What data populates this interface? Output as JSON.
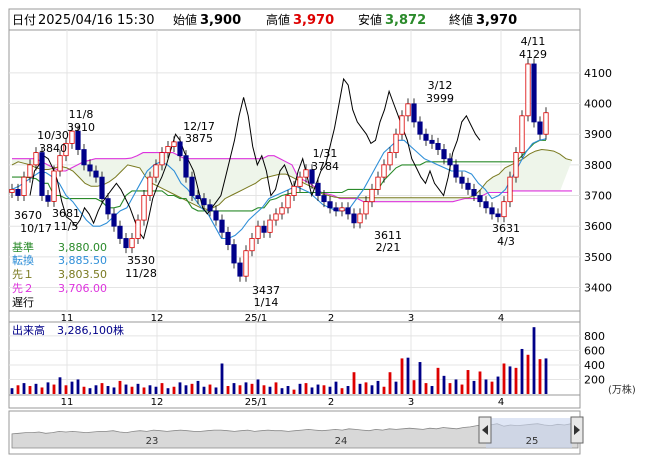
{
  "header": {
    "date_label": "日付",
    "date": "2025/04/16 15:30",
    "open_label": "始値",
    "open": "3,900",
    "high_label": "高値",
    "high": "3,970",
    "low_label": "安値",
    "low": "3,872",
    "close_label": "終値",
    "close": "3,970"
  },
  "legend": {
    "kijun_label": "基準",
    "kijun_value": "3,880.00",
    "tenkan_label": "転換",
    "tenkan_value": "3,885.50",
    "senkou1_label": "先１",
    "senkou1_value": "3,803.50",
    "senkou2_label": "先２",
    "senkou2_value": "3,706.00",
    "chikou_label": "遅行"
  },
  "volume_panel": {
    "label": "出来高",
    "value": "3,286,100株",
    "unit": "(万株)"
  },
  "colors": {
    "up": "#dd0000",
    "down": "#000088",
    "kijun": "#2a8a2a",
    "tenkan": "#2f8fd8",
    "senkou1": "#7a7a20",
    "senkou2": "#dd33dd",
    "chikou": "#000000",
    "cloud": "#eef5ea"
  },
  "chart_data": [
    {
      "type": "candlestick",
      "title": "",
      "y_ticks": [
        3400,
        3500,
        3600,
        3700,
        3800,
        3900,
        4000,
        4100
      ],
      "ylim": [
        3330,
        4230
      ],
      "x_ticks": [
        "11",
        "12",
        "25/1",
        "2",
        "3",
        "4"
      ],
      "series": [
        {
          "name": "kijun",
          "values": [
            3760,
            3760,
            3760,
            3758,
            3755,
            3740,
            3740,
            3700,
            3700,
            3690,
            3690,
            3690,
            3690,
            3690,
            3690,
            3680,
            3660,
            3660,
            3665,
            3700,
            3715,
            3715,
            3715,
            3715,
            3715,
            3715,
            3700,
            3700,
            3690,
            3690,
            3660,
            3650,
            3650,
            3650,
            3650,
            3650,
            3650,
            3650,
            3650,
            3650,
            3650,
            3660,
            3660,
            3685,
            3690,
            3700,
            3705,
            3710,
            3710,
            3710,
            3710,
            3710,
            3710,
            3710,
            3710,
            3710,
            3720,
            3720,
            3720,
            3720,
            3720,
            3720,
            3750,
            3770,
            3790,
            3800,
            3800,
            3800,
            3800,
            3810,
            3810,
            3810,
            3810,
            3810,
            3810,
            3810,
            3810,
            3810,
            3810,
            3810,
            3810,
            3810,
            3810,
            3810,
            3810,
            3830,
            3850,
            3870,
            3880,
            3880
          ]
        },
        {
          "name": "tenkan",
          "values": [
            3720,
            3730,
            3745,
            3760,
            3775,
            3775,
            3760,
            3740,
            3700,
            3680,
            3650,
            3620,
            3600,
            3600,
            3610,
            3630,
            3650,
            3660,
            3700,
            3740,
            3780,
            3800,
            3810,
            3800,
            3780,
            3740,
            3720,
            3690,
            3660,
            3640,
            3600,
            3560,
            3560,
            3570,
            3590,
            3620,
            3640,
            3660,
            3690,
            3700,
            3710,
            3720,
            3730,
            3720,
            3710,
            3690,
            3670,
            3660,
            3650,
            3650,
            3660,
            3690,
            3720,
            3760,
            3800,
            3840,
            3860,
            3880,
            3880,
            3860,
            3840,
            3820,
            3810,
            3800,
            3790,
            3780,
            3780,
            3780,
            3770,
            3740,
            3720,
            3690,
            3700,
            3720,
            3760,
            3800,
            3840,
            3870,
            3880,
            3885
          ]
        },
        {
          "name": "senkou1",
          "values": [
            3800,
            3810,
            3805,
            3800,
            3790,
            3785,
            3785,
            3790,
            3795,
            3790,
            3780,
            3760,
            3740,
            3730,
            3730,
            3735,
            3745,
            3760,
            3780,
            3800,
            3795,
            3790,
            3760,
            3740,
            3730,
            3720,
            3710,
            3700,
            3690,
            3680,
            3670,
            3660,
            3655,
            3660,
            3670,
            3690,
            3700,
            3710,
            3720,
            3730,
            3740,
            3755,
            3760,
            3765,
            3770,
            3770,
            3760,
            3750,
            3740,
            3730,
            3720,
            3705,
            3700,
            3695,
            3693,
            3693,
            3693,
            3693,
            3693,
            3693,
            3693,
            3693,
            3693,
            3693,
            3693,
            3693,
            3693,
            3693,
            3693,
            3693,
            3693,
            3693,
            3693,
            3693,
            3693,
            3693,
            3700,
            3720,
            3745,
            3760,
            3770,
            3790,
            3800,
            3810,
            3820,
            3835,
            3845,
            3850,
            3848,
            3845,
            3835,
            3820,
            3815
          ]
        },
        {
          "name": "senkou2",
          "values": [
            3820,
            3820,
            3820,
            3820,
            3820,
            3810,
            3800,
            3790,
            3780,
            3780,
            3790,
            3800,
            3810,
            3815,
            3820,
            3820,
            3820,
            3820,
            3820,
            3820,
            3822,
            3830,
            3840,
            3840,
            3840,
            3840,
            3840,
            3840,
            3830,
            3820,
            3820,
            3820,
            3820,
            3820,
            3820,
            3820,
            3820,
            3820,
            3820,
            3820,
            3820,
            3820,
            3820,
            3830,
            3830,
            3820,
            3810,
            3800,
            3760,
            3750,
            3740,
            3725,
            3710,
            3705,
            3700,
            3690,
            3690,
            3690,
            3690,
            3680,
            3680,
            3680,
            3680,
            3680,
            3680,
            3680,
            3680,
            3680,
            3680,
            3680,
            3680,
            3680,
            3680,
            3680,
            3680,
            3685,
            3690,
            3690,
            3690,
            3700,
            3710,
            3710,
            3710,
            3710,
            3715,
            3715,
            3715,
            3715,
            3715,
            3715,
            3715,
            3715,
            3715,
            3715,
            3715
          ]
        },
        {
          "name": "chikou",
          "values": [
            3700,
            3780,
            3800,
            3830,
            3820,
            3790,
            3750,
            3680,
            3630,
            3620,
            3600,
            3620,
            3660,
            3640,
            3610,
            3650,
            3680,
            3700,
            3720,
            3740,
            3720,
            3690,
            3660,
            3620,
            3580,
            3560,
            3620,
            3690,
            3730,
            3760,
            3800,
            3850,
            3900,
            3880,
            3840,
            3810,
            3780,
            3720,
            3660,
            3640,
            3660,
            3680,
            3700,
            3760,
            3820,
            3880,
            3960,
            4020,
            3960,
            3860,
            3800,
            3830,
            3780,
            3700,
            3720,
            3780,
            3800,
            3760,
            3720,
            3780,
            3820,
            3760,
            3700,
            3740,
            3780,
            3800,
            3860,
            3920,
            4000,
            4080,
            4060,
            3980,
            3940,
            3920,
            3900,
            3870,
            3880,
            3940,
            3980,
            4040,
            4000,
            3960,
            3920,
            3880,
            3820,
            3790,
            3760,
            3740,
            3780,
            3740,
            3720,
            3700,
            3760,
            3840,
            3880,
            3940,
            3960,
            3930,
            3900,
            3880
          ]
        },
        {
          "name": "price",
          "values": [
            3720,
            3700,
            3760,
            3800,
            3840,
            3700,
            3681,
            3780,
            3830,
            3870,
            3910,
            3850,
            3800,
            3780,
            3760,
            3690,
            3640,
            3600,
            3560,
            3530,
            3560,
            3620,
            3700,
            3760,
            3800,
            3840,
            3860,
            3875,
            3830,
            3760,
            3700,
            3690,
            3670,
            3650,
            3620,
            3580,
            3540,
            3480,
            3437,
            3520,
            3560,
            3600,
            3580,
            3620,
            3640,
            3660,
            3700,
            3730,
            3760,
            3784,
            3740,
            3700,
            3680,
            3660,
            3650,
            3660,
            3640,
            3611,
            3640,
            3680,
            3720,
            3760,
            3800,
            3840,
            3900,
            3960,
            3999,
            3940,
            3900,
            3880,
            3870,
            3850,
            3820,
            3800,
            3760,
            3740,
            3720,
            3700,
            3680,
            3660,
            3640,
            3631,
            3680,
            3760,
            3840,
            3960,
            4129,
            3940,
            3900,
            3970
          ]
        }
      ],
      "annotations": [
        "10/17",
        "3670",
        "3681",
        "11/5",
        "10/30",
        "3840",
        "11/8",
        "3910",
        "3530",
        "11/28",
        "12/17",
        "3875",
        "3437",
        "1/14",
        "1/31",
        "3784",
        "3611",
        "2/21",
        "3/12",
        "3999",
        "4/11",
        "4129",
        "3631",
        "4/3"
      ]
    },
    {
      "type": "bar",
      "title": "",
      "y_ticks": [
        200,
        400,
        600,
        800
      ],
      "ylim": [
        0,
        950
      ],
      "x_ticks": [
        "11",
        "12",
        "25/1",
        "2",
        "3",
        "4"
      ],
      "values": [
        80,
        120,
        150,
        110,
        140,
        90,
        160,
        130,
        230,
        120,
        170,
        200,
        100,
        80,
        120,
        150,
        110,
        90,
        180,
        130,
        100,
        140,
        90,
        120,
        100,
        150,
        80,
        100,
        160,
        120,
        140,
        180,
        100,
        130,
        90,
        420,
        110,
        150,
        120,
        160,
        140,
        200,
        120,
        100,
        160,
        80,
        110,
        60,
        140,
        150,
        90,
        130,
        120,
        100,
        170,
        80,
        110,
        300,
        140,
        160,
        120,
        180,
        100,
        300,
        170,
        490,
        500,
        190,
        440,
        150,
        110,
        360,
        250,
        150,
        200,
        130,
        330,
        180,
        310,
        200,
        170,
        240,
        420,
        380,
        360,
        620,
        540,
        920,
        480,
        490
      ],
      "up": [
        false,
        true,
        false,
        true,
        false,
        true,
        false,
        true,
        false,
        true,
        false,
        false,
        true,
        false,
        false,
        true,
        false,
        false,
        true,
        false,
        true,
        false,
        true,
        false,
        false,
        true,
        false,
        true,
        false,
        false,
        true,
        false,
        false,
        true,
        false,
        false,
        true,
        false,
        true,
        false,
        true,
        false,
        true,
        false,
        true,
        false,
        false,
        true,
        false,
        true,
        false,
        false,
        true,
        false,
        false,
        true,
        false,
        true,
        false,
        true,
        false,
        false,
        true,
        true,
        false,
        true,
        false,
        true,
        false,
        true,
        false,
        true,
        false,
        true,
        false,
        true,
        true,
        false,
        true,
        false,
        true,
        false,
        true,
        false,
        true,
        false,
        true,
        false,
        true,
        false
      ]
    },
    {
      "type": "area",
      "title": "",
      "x_ticks": [
        "23",
        "24",
        "25"
      ],
      "values": [
        62,
        63,
        64,
        64,
        65,
        63,
        64,
        66,
        65,
        66,
        65,
        64,
        65,
        66,
        66,
        67,
        65,
        64,
        66,
        67,
        66,
        68,
        67,
        66,
        67,
        68,
        67,
        66,
        66,
        67,
        68,
        68,
        67,
        66,
        67,
        68,
        66,
        67,
        68,
        67,
        67,
        66,
        67,
        68,
        69,
        68,
        67,
        68,
        69,
        68,
        70,
        69,
        68,
        67,
        69,
        68,
        70,
        69,
        70,
        71,
        70,
        69,
        71,
        70,
        72,
        71,
        70,
        72,
        73,
        75,
        77,
        76,
        78,
        74,
        76,
        75,
        76,
        77,
        78,
        76,
        75,
        77,
        76,
        78,
        77
      ]
    }
  ]
}
